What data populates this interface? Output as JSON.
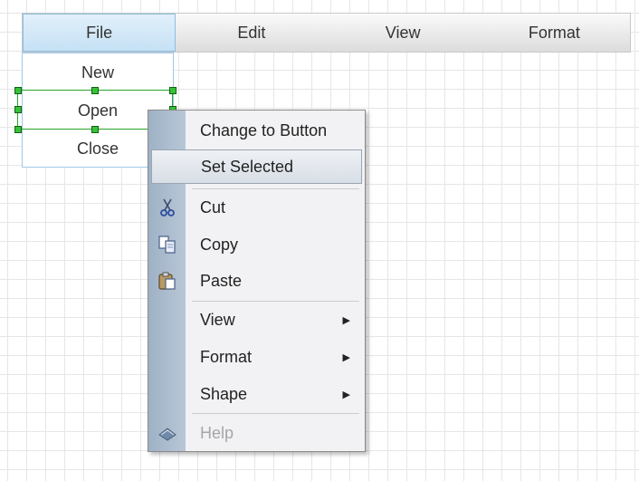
{
  "menubar": {
    "items": [
      "File",
      "Edit",
      "View",
      "Format"
    ]
  },
  "file_menu": {
    "items": [
      "New",
      "Open",
      "Close"
    ]
  },
  "context_menu": {
    "change_to_button": "Change to Button",
    "set_selected": "Set Selected",
    "cut": "Cut",
    "copy": "Copy",
    "paste": "Paste",
    "view": "View",
    "format": "Format",
    "shape": "Shape",
    "help": "Help"
  },
  "icons": {
    "cut": "scissors-icon",
    "copy": "copy-icon",
    "paste": "paste-icon",
    "help": "help-book-icon",
    "submenu": "submenu-arrow-icon"
  },
  "colors": {
    "selection_handle": "#36c236",
    "active_tab": "#c5e1f5",
    "context_gutter": "#9fb1c6"
  }
}
